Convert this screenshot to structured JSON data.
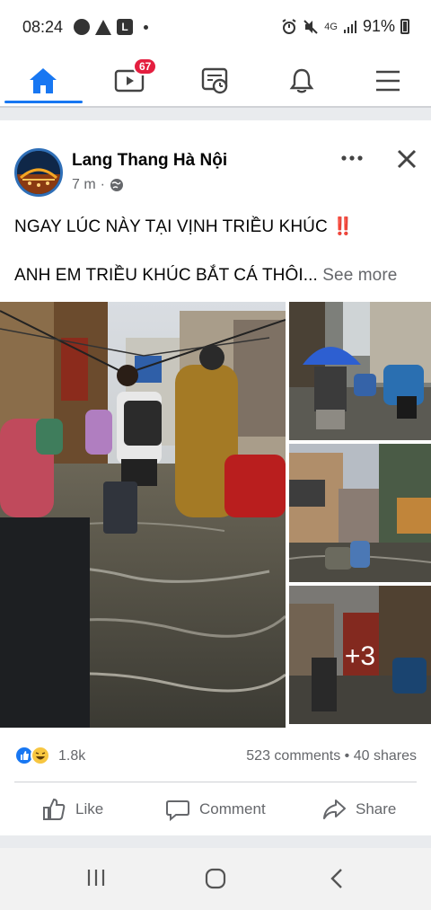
{
  "status_bar": {
    "time": "08:24",
    "notif_letter": "L",
    "network": "4G",
    "battery": "91%"
  },
  "nav": {
    "items": [
      {
        "name": "home",
        "icon": "home-icon",
        "active": true
      },
      {
        "name": "watch",
        "icon": "video-icon",
        "badge": "67"
      },
      {
        "name": "feeds",
        "icon": "feed-clock-icon"
      },
      {
        "name": "notifications",
        "icon": "bell-icon"
      },
      {
        "name": "menu",
        "icon": "hamburger-icon"
      }
    ],
    "accent": "#1877f2"
  },
  "post": {
    "page_name": "Lang Thang Hà Nội",
    "time_ago": "7 m",
    "separator": "·",
    "text_line1": "NGAY LÚC NÀY TẠI VỊNH TRIỀU KHÚC ‼️",
    "text_line2": "ANH EM TRIỀU KHÚC BẮT CÁ THÔI...",
    "see_more": "See more",
    "extra_photos": "+3",
    "reactions_count": "1.8k",
    "comments": "523 comments",
    "shares": "40 shares",
    "dot": "•"
  },
  "actions": {
    "like": "Like",
    "comment": "Comment",
    "share": "Share"
  }
}
